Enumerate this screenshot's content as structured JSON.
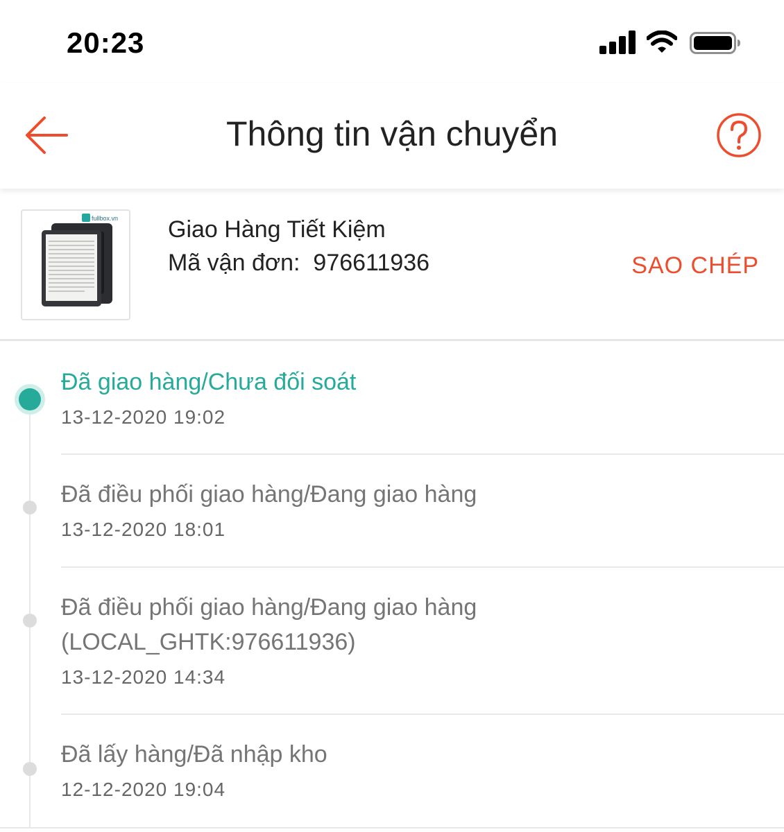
{
  "status_bar": {
    "time": "20:23"
  },
  "header": {
    "title": "Thông tin vận chuyển"
  },
  "shipment": {
    "carrier": "Giao Hàng Tiết Kiệm",
    "tracking_label": "Mã vận đơn:",
    "tracking_number": "976611936",
    "copy_label": "SAO CHÉP",
    "thumbnail_logo": "fullbox.vn"
  },
  "events": [
    {
      "status": "Đã giao hàng/Chưa đối soát",
      "status_line2": "",
      "time": "13-12-2020 19:02",
      "active": true
    },
    {
      "status": "Đã điều phối giao hàng/Đang giao hàng",
      "status_line2": "",
      "time": "13-12-2020 18:01",
      "active": false
    },
    {
      "status": "Đã điều phối giao hàng/Đang giao hàng",
      "status_line2": "(LOCAL_GHTK:976611936)",
      "time": "13-12-2020 14:34",
      "active": false
    },
    {
      "status": "Đã lấy hàng/Đã nhập kho",
      "status_line2": "",
      "time": "12-12-2020 19:04",
      "active": false
    }
  ],
  "colors": {
    "accent": "#ee4d2d",
    "active_status": "#26aa99",
    "inactive_dot": "#dcdcdc"
  }
}
